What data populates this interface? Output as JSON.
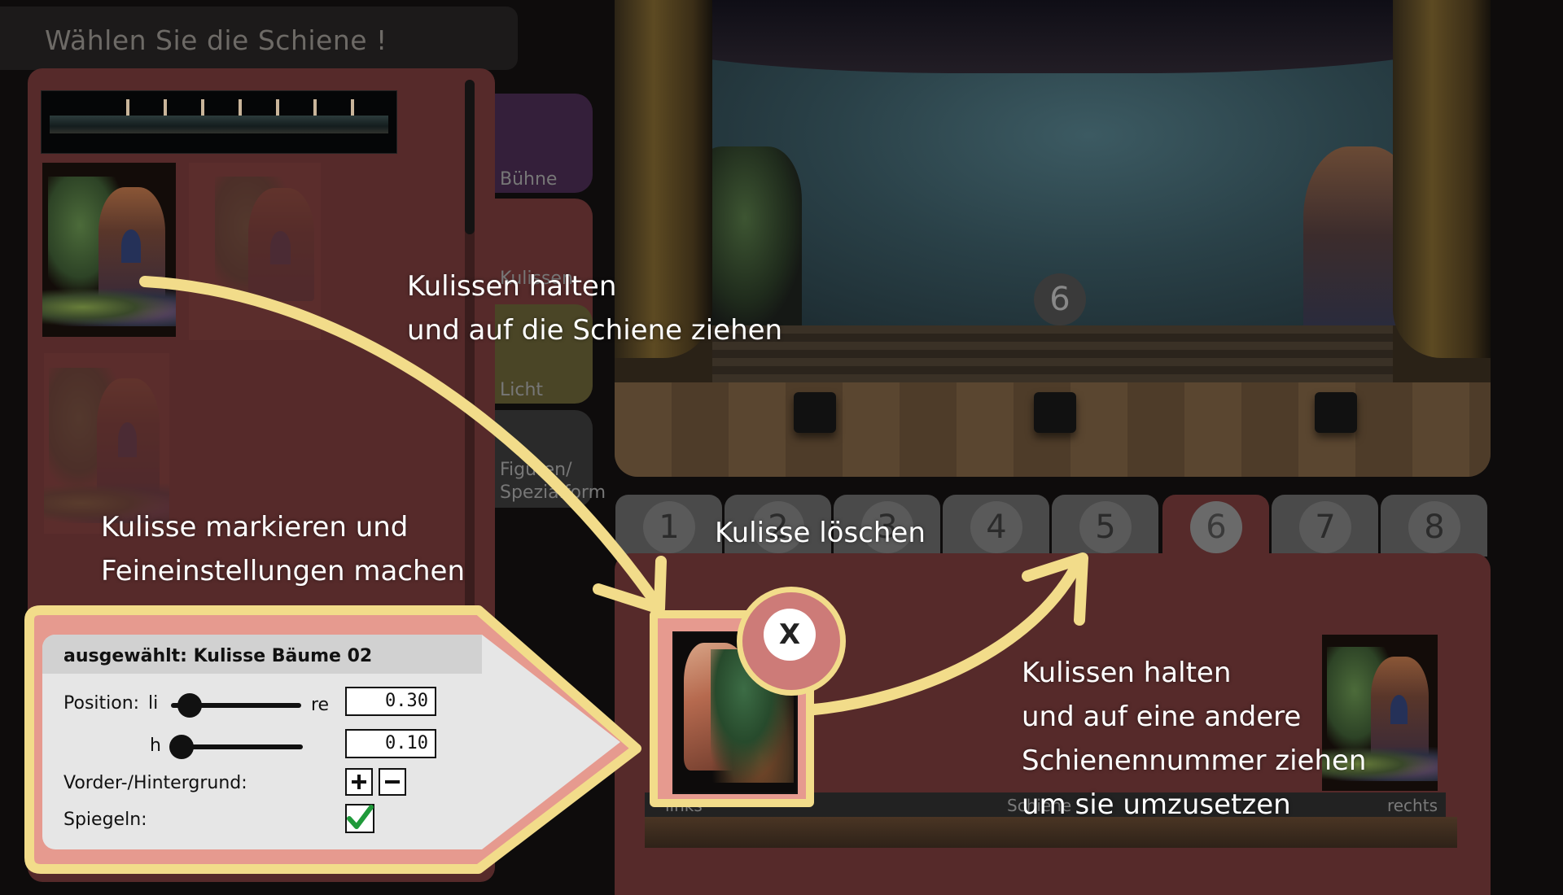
{
  "title": "Wählen Sie die Schiene !",
  "categories": [
    {
      "label": "Bühne",
      "color": "#341f3a"
    },
    {
      "label": "Kulissen",
      "color": "#562a2a"
    },
    {
      "label": "Licht",
      "color": "#4a4526"
    },
    {
      "label": "Figuren/ Spezialform",
      "color": "#2a2a2a"
    }
  ],
  "stage": {
    "rail_badge": "6"
  },
  "rail_tabs": [
    "1",
    "2",
    "3",
    "4",
    "5",
    "6",
    "7",
    "8"
  ],
  "active_rail": "6",
  "rail_editor": {
    "left_label": "links",
    "center_label": "Schiene",
    "right_label": "rechts",
    "delete_label": "X"
  },
  "settings": {
    "header": "ausgewählt: Kulisse Bäume 02",
    "position_label": "Position:",
    "left_short": "li",
    "right_short": "re",
    "position_value": "0.30",
    "height_label": "h",
    "height_value": "0.10",
    "depth_label": "Vorder-/Hintergrund:",
    "mirror_label": "Spiegeln:",
    "mirror_checked": true
  },
  "annotations": {
    "drag_to_rail": "Kulissen halten\nund auf die Schiene ziehen",
    "mark_and_adjust": "Kulisse markieren und\nFeineinstellungen machen",
    "delete": "Kulisse löschen",
    "move_rail": "Kulissen halten\nund auf eine andere\nSchienennummer ziehen\num sie umzusetzen"
  },
  "colors": {
    "accent_highlight": "#f2dc8a",
    "panel": "#562a2a",
    "delete_ring": "#cd7b78"
  },
  "icons": {
    "mirror_checkbox": "checkmark-icon",
    "delete": "close-icon",
    "foreground": "plus-icon",
    "background": "minus-icon"
  }
}
